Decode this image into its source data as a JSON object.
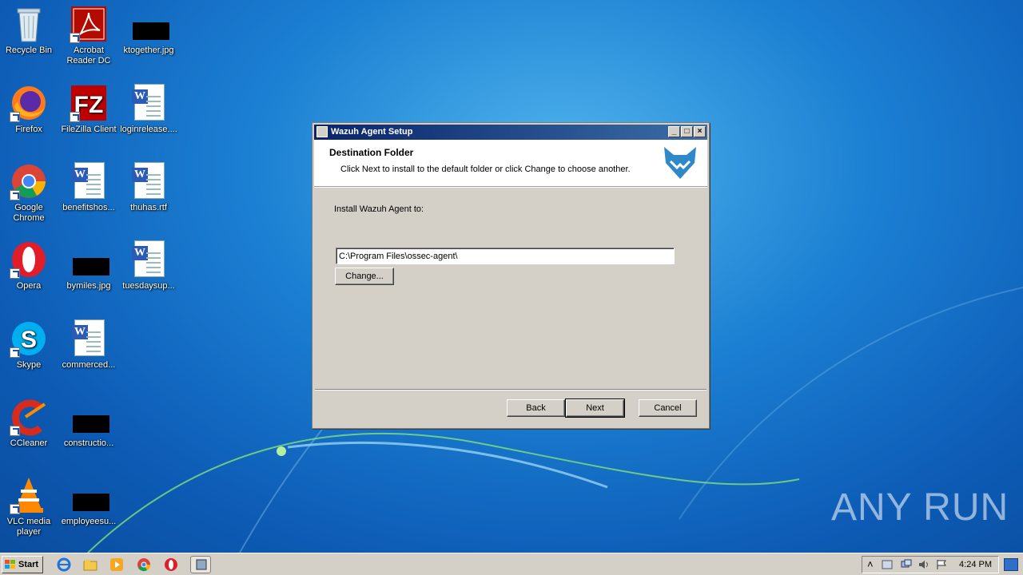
{
  "desktop_icons": [
    {
      "label": "Recycle Bin",
      "icon": "recycle-bin-icon"
    },
    {
      "label": "Acrobat Reader DC",
      "icon": "acrobat-icon"
    },
    {
      "label": "ktogether.jpg",
      "icon": "image-file-icon"
    },
    {
      "label": "Firefox",
      "icon": "firefox-icon"
    },
    {
      "label": "FileZilla Client",
      "icon": "filezilla-icon"
    },
    {
      "label": "loginrelease....",
      "icon": "word-doc-icon"
    },
    {
      "label": "Google Chrome",
      "icon": "chrome-icon"
    },
    {
      "label": "benefitshos...",
      "icon": "word-doc-icon"
    },
    {
      "label": "thuhas.rtf",
      "icon": "word-doc-icon"
    },
    {
      "label": "Opera",
      "icon": "opera-icon"
    },
    {
      "label": "bymiles.jpg",
      "icon": "image-file-icon"
    },
    {
      "label": "tuesdaysup...",
      "icon": "word-doc-icon"
    },
    {
      "label": "Skype",
      "icon": "skype-icon"
    },
    {
      "label": "commerced...",
      "icon": "word-doc-icon"
    },
    {
      "label": "CCleaner",
      "icon": "ccleaner-icon"
    },
    {
      "label": "constructio...",
      "icon": "image-file-icon"
    },
    {
      "label": "VLC media player",
      "icon": "vlc-icon"
    },
    {
      "label": "employeesu...",
      "icon": "image-file-icon"
    }
  ],
  "dialog": {
    "title": "Wazuh Agent Setup",
    "header_title": "Destination Folder",
    "header_subtitle": "Click Next to install to the default folder or click Change to choose another.",
    "install_label": "Install Wazuh Agent to:",
    "path_value": "C:\\Program Files\\ossec-agent\\",
    "change_label": "Change...",
    "back_label": "Back",
    "next_label": "Next",
    "cancel_label": "Cancel",
    "minimize_glyph": "_",
    "maximize_glyph": "□",
    "close_glyph": "×"
  },
  "watermark": "ANY RUN",
  "taskbar": {
    "start_label": "Start",
    "clock": "4:24 PM",
    "expand_glyph": "˄"
  }
}
